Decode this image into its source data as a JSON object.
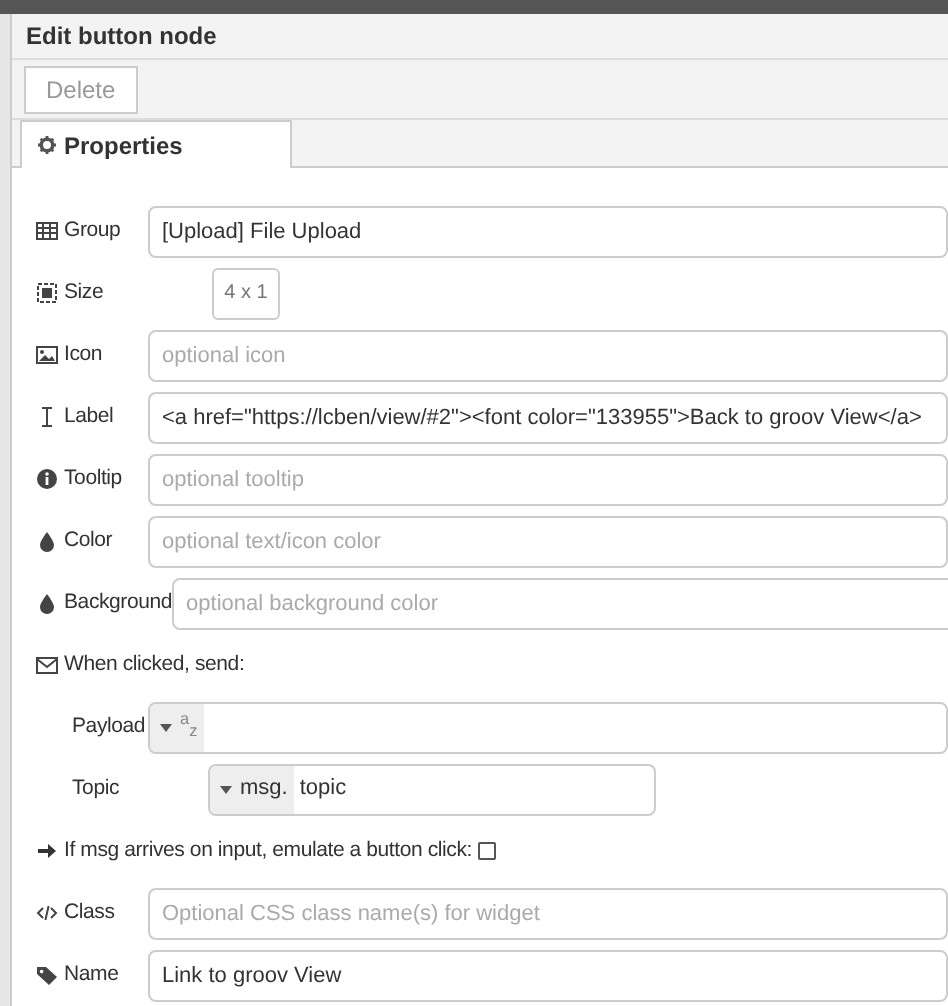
{
  "dialog": {
    "title": "Edit button node"
  },
  "toolbar": {
    "buttons": [
      {
        "label": "Delete",
        "disabled": true
      }
    ]
  },
  "tabs": [
    {
      "label": "Properties",
      "selected": true
    }
  ],
  "rows": [
    {
      "kind": "input",
      "label": "Group",
      "value": "[Upload] File Upload"
    },
    {
      "kind": "size",
      "label": "Size",
      "value": "4 x 1"
    },
    {
      "kind": "input",
      "label": "Icon",
      "placeholder": "optional icon"
    },
    {
      "kind": "input",
      "label": "Label",
      "value": "<a href=\"https://lcben/view/#2\"><font color=\"133955\">Back to groov View</a>"
    },
    {
      "kind": "input",
      "label": "Tooltip",
      "placeholder": "optional tooltip"
    },
    {
      "kind": "input",
      "label": "Color",
      "placeholder": "optional text/icon color"
    },
    {
      "kind": "input",
      "label": "Background",
      "placeholder": "optional background color"
    },
    {
      "kind": "heading",
      "label": "When clicked, send:"
    },
    {
      "kind": "typed",
      "label": "Payload",
      "type_label": "$^{a}$$_{z}$",
      "wide": true
    },
    {
      "kind": "typed",
      "label": "Topic",
      "type_label": "msg.",
      "value": "topic",
      "wide": false
    },
    {
      "kind": "checkbox",
      "label": "If msg arrives on input, emulate a button click:",
      "checked": false
    },
    {
      "kind": "input",
      "label": "Class",
      "placeholder": "Optional CSS class name(s) for widget"
    },
    {
      "kind": "input",
      "label": "Name",
      "value": "Link to groov View"
    }
  ]
}
